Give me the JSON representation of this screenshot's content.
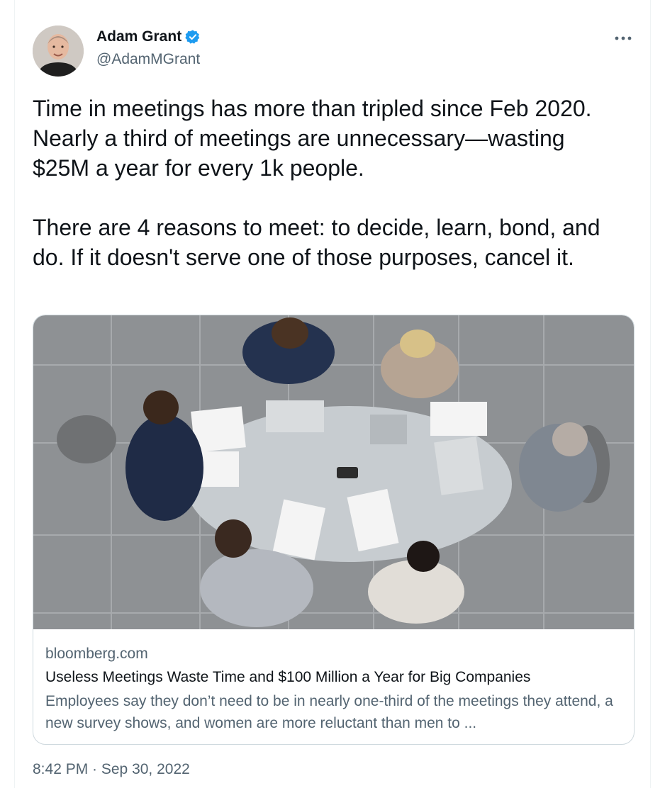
{
  "author": {
    "name": "Adam Grant",
    "handle": "@AdamMGrant",
    "verified_color": "#1d9bf0"
  },
  "tweet": {
    "text": "Time in meetings has more than tripled since Feb 2020. Nearly a third of meetings are unnecessary—wasting $25M a year for every 1k people.\n\nThere are 4 reasons to meet: to decide, learn, bond, and do. If it doesn't serve one of those purposes, cancel it.",
    "timestamp": "8:42 PM · Sep 30, 2022"
  },
  "link_card": {
    "domain": "bloomberg.com",
    "title": "Useless Meetings Waste Time and $100 Million a Year for Big Companies",
    "description": "Employees say they don’t need to be in nearly one-third of the meetings they attend, a new survey shows, and women are more reluctant than men to ..."
  },
  "icons": {
    "verified": "verified-badge-icon",
    "more": "more-options-icon"
  }
}
